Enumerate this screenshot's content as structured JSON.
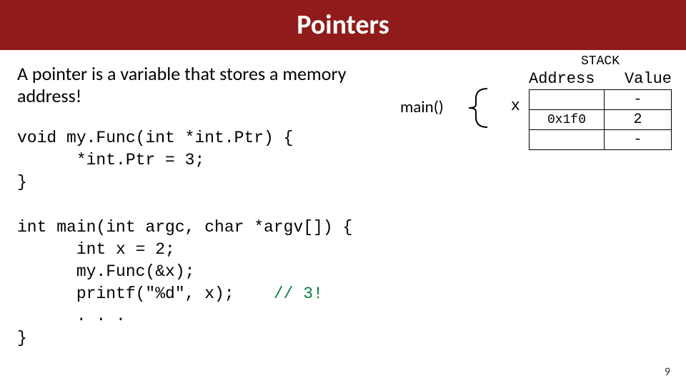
{
  "title": "Pointers",
  "intro": "A pointer is a variable that stores a memory address!",
  "code": {
    "func_sig": "void my.Func(int *int.Ptr) {",
    "func_body": "      *int.Ptr = 3;",
    "func_close": "}",
    "main_sig": "int main(int argc, char *argv[]) {",
    "main_l1": "      int x = 2;",
    "main_l2": "      my.Func(&x);",
    "main_l3a": "      printf(\"%d\", x);    ",
    "main_l3_comment": "// 3!",
    "main_l4": "      . . .",
    "main_close": "}"
  },
  "diagram": {
    "main_label": "main()",
    "var_label": "x",
    "stack_title": "STACK",
    "header_addr": "Address",
    "header_val": "Value",
    "rows": [
      {
        "addr": "",
        "val": "-"
      },
      {
        "addr": "0x1f0",
        "val": "2"
      },
      {
        "addr": "",
        "val": "-"
      }
    ]
  },
  "page_number": "9"
}
